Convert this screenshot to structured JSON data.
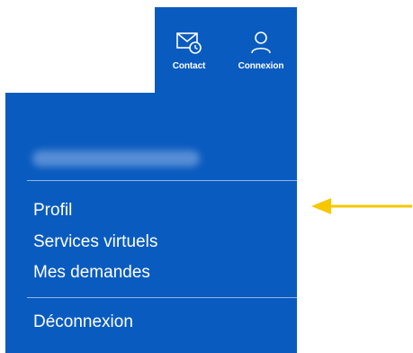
{
  "header": {
    "contact_label": "Contact",
    "login_label": "Connexion"
  },
  "menu": {
    "items": [
      {
        "label": "Profil"
      },
      {
        "label": "Services virtuels"
      },
      {
        "label": "Mes demandes"
      }
    ],
    "logout_label": "Déconnexion"
  },
  "colors": {
    "panel_blue": "#0a5bbf",
    "arrow_yellow": "#f5c800"
  },
  "icons": {
    "contact": "envelope-clock-icon",
    "login": "user-icon",
    "pointer": "arrow-left-icon"
  }
}
